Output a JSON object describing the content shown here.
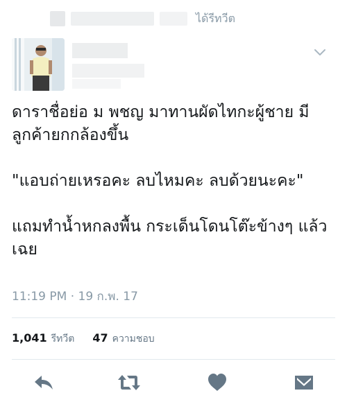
{
  "retweet_header": {
    "label": "ได้รีทวีต"
  },
  "tweet": {
    "paragraphs": [
      "ดาราชื่อย่อ ม พชญ มาทานผัดไทกะผู้ชาย มีลูกค้ายกกล้องขึ้น",
      "\"แอบถ่ายเหรอคะ ลบไหมคะ ลบด้วยนะคะ\"",
      "แถมทำน้ำหกลงพื้น กระเด็นโดนโต๊ะข้างๆ แล้วเฉย"
    ],
    "timestamp": "11:19 PM · 19 ก.พ. 17"
  },
  "stats": {
    "retweets_count": "1,041",
    "retweets_label": "รีทวีต",
    "likes_count": "47",
    "likes_label": "ความชอบ"
  },
  "icons": {
    "reply": "reply-icon",
    "retweet": "retweet-icon",
    "like": "heart-icon",
    "message": "envelope-icon",
    "more": "chevron-down-icon"
  },
  "colors": {
    "text": "#14171a",
    "muted": "#8899a6",
    "icon": "#657786",
    "divider": "#e1e8ed"
  }
}
